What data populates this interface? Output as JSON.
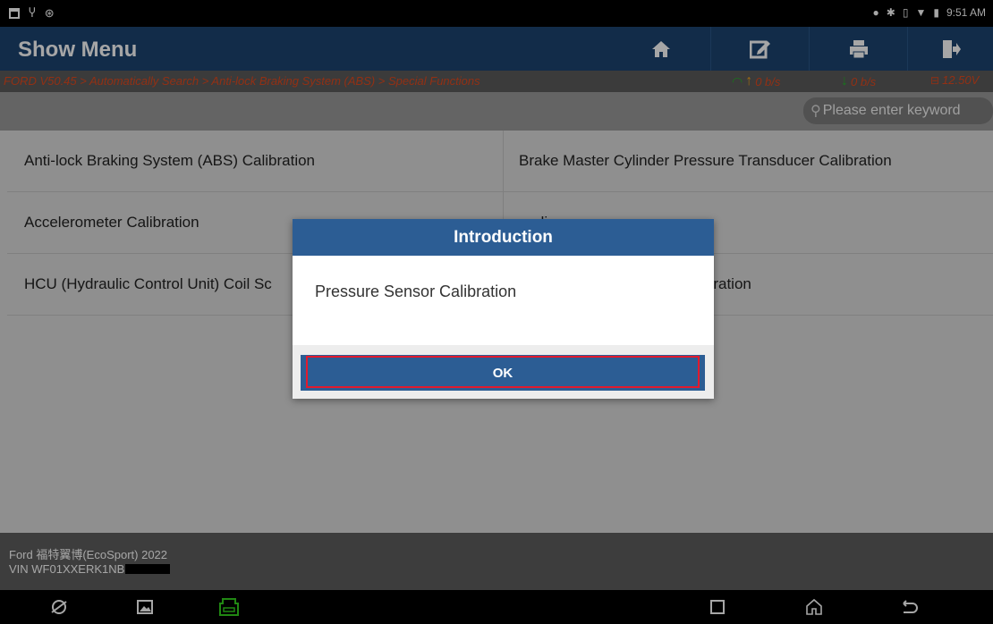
{
  "status_bar": {
    "left_icons": [
      "image-icon",
      "usb-icon",
      "settings-dot-icon"
    ],
    "right_icons": [
      "location-icon",
      "bluetooth-icon",
      "vibrate-icon",
      "wifi-icon",
      "battery-icon"
    ],
    "time": "9:51 AM"
  },
  "header": {
    "title": "Show Menu",
    "buttons": [
      "home-icon",
      "edit-icon",
      "print-icon",
      "exit-icon"
    ]
  },
  "breadcrumb": {
    "path": "FORD V50.45 > Automatically Search > Anti-lock Braking System (ABS) > Special Functions",
    "upload_speed": "0 b/s",
    "download_speed": "0 b/s",
    "voltage": "12.50V"
  },
  "search": {
    "placeholder": "Please enter keyword"
  },
  "menu": {
    "items": [
      "Anti-lock Braking System (ABS) Calibration",
      "Brake Master Cylinder Pressure Transducer Calibration",
      "Accelerometer Calibration",
      "eeding",
      "HCU (Hydraulic Control Unit) Coil Sc",
      "(ABS) Module Bleed Configuration"
    ]
  },
  "footer": {
    "model": "Ford 福特翼博(EcoSport) 2022",
    "vin": "VIN WF01XXERK1NB"
  },
  "nav_bar": {
    "icons": [
      "browser-icon",
      "gallery-icon",
      "vci-icon",
      "recents-icon",
      "home-icon",
      "back-icon"
    ]
  },
  "dialog": {
    "title": "Introduction",
    "message": "Pressure Sensor Calibration",
    "ok_label": "OK",
    "highlight_color": "#e21a2d"
  },
  "colors": {
    "header_bg": "#1c4471",
    "dialog_header_bg": "#2c5d94",
    "breadcrumb_text": "#e04a1f",
    "signal_green": "#27b32b"
  }
}
